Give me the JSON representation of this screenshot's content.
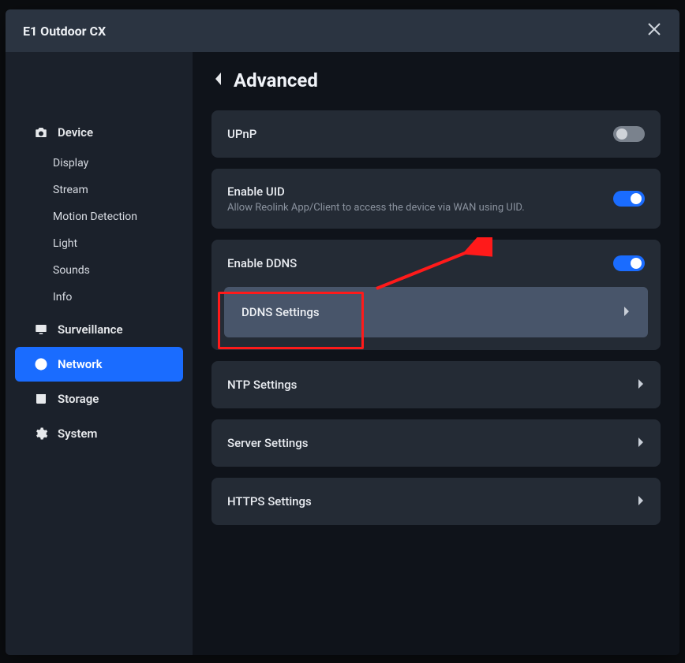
{
  "window": {
    "title": "E1 Outdoor CX"
  },
  "sidebar": {
    "device": {
      "label": "Device"
    },
    "device_subs": {
      "display": "Display",
      "stream": "Stream",
      "motion": "Motion Detection",
      "light": "Light",
      "sounds": "Sounds",
      "info": "Info"
    },
    "surveillance": {
      "label": "Surveillance"
    },
    "network": {
      "label": "Network"
    },
    "storage": {
      "label": "Storage"
    },
    "system": {
      "label": "System"
    }
  },
  "page": {
    "title": "Advanced"
  },
  "rows": {
    "upnp": {
      "label": "UPnP",
      "enabled": false
    },
    "uid": {
      "label": "Enable UID",
      "desc": "Allow Reolink App/Client to access the device via WAN using UID.",
      "enabled": true
    },
    "ddns_enable": {
      "label": "Enable DDNS",
      "enabled": true
    },
    "ddns_nav": {
      "label": "DDNS Settings"
    },
    "ntp": {
      "label": "NTP Settings"
    },
    "server": {
      "label": "Server Settings"
    },
    "https": {
      "label": "HTTPS Settings"
    }
  }
}
